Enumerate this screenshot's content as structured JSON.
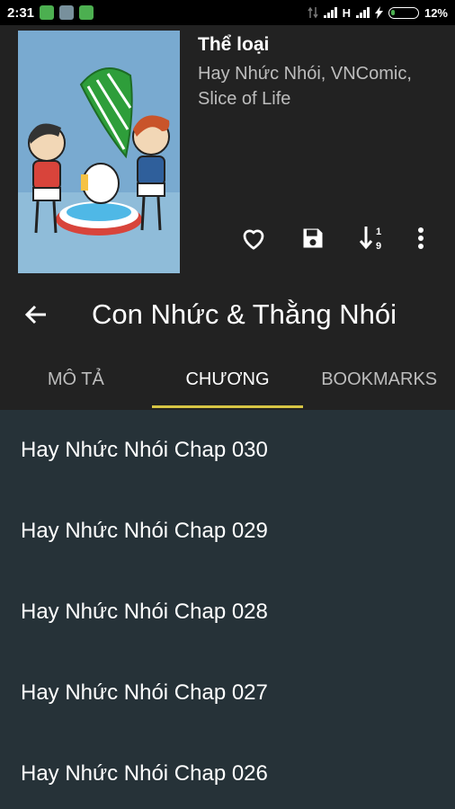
{
  "status_bar": {
    "time": "2:31",
    "network_type": "H",
    "battery_percent": "12%",
    "battery_level": 0.12
  },
  "manga": {
    "genre_heading": "Thể loại",
    "genre_value": " Hay Nhức Nhói, VNComic, Slice of Life"
  },
  "actions": {
    "favorite_icon": "heart-outline-icon",
    "save_icon": "floppy-icon",
    "sort_icon": "sort-numeric-icon",
    "more_icon": "more-vertical-icon"
  },
  "appbar": {
    "back_icon": "arrow-left-icon",
    "title": "Con Nhức & Thằng Nhói"
  },
  "tabs": [
    {
      "label": "MÔ TẢ",
      "active": false
    },
    {
      "label": "CHƯƠNG",
      "active": true
    },
    {
      "label": "BOOKMARKS",
      "active": false
    }
  ],
  "chapters": [
    "Hay Nhức Nhói Chap 030",
    "Hay Nhức Nhói Chap 029",
    "Hay Nhức Nhói Chap 028",
    "Hay Nhức Nhói Chap 027",
    "Hay Nhức Nhói Chap 026"
  ],
  "colors": {
    "header_bg": "#222222",
    "list_bg": "#263238",
    "tab_indicator": "#d7c544"
  }
}
